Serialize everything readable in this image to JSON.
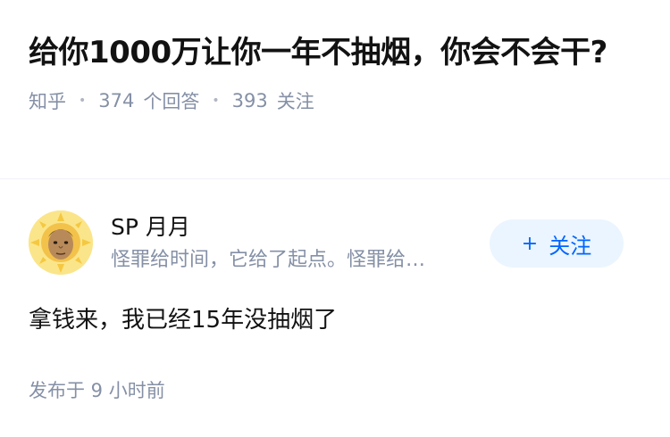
{
  "question": {
    "title": "给你1000万让你一年不抽烟，你会不会干?",
    "source": "知乎",
    "answer_count": "374",
    "answer_label": "个回答",
    "follower_count": "393",
    "follower_label": "关注"
  },
  "author": {
    "name": "SP 月月",
    "bio": "怪罪给时间，它给了起点。怪罪给…",
    "avatar_icon": "sun-face-avatar",
    "follow_icon": "plus-icon",
    "follow_label": "关注"
  },
  "answer": {
    "text": "拿钱来，我已经15年没抽烟了",
    "published": "发布于 9 小时前"
  },
  "colors": {
    "title": "#121212",
    "meta": "#8590a6",
    "accent": "#0066ff",
    "follow_bg": "#ebf5ff"
  }
}
